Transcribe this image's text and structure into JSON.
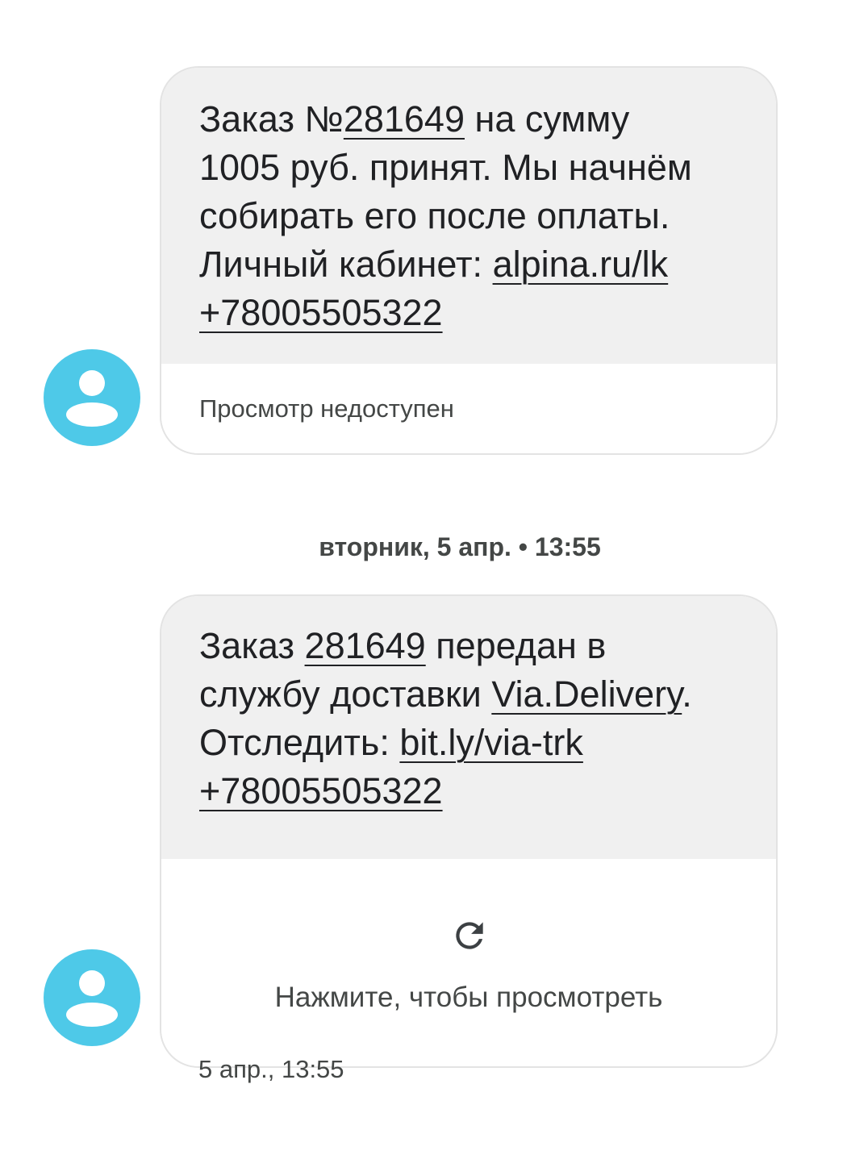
{
  "messages": [
    {
      "text": {
        "l1_a": "Заказ №",
        "l1_link": "281649",
        "l1_b": " на сумму",
        "l2": "1005 руб. принят. Мы начнём",
        "l3": "собирать его после оплаты.",
        "l4_a": "Личный кабинет: ",
        "l4_link": "alpina.ru/lk",
        "l5_link": "+78005505322"
      },
      "preview": "Просмотр недоступен"
    },
    {
      "text": {
        "l1_a": "Заказ ",
        "l1_link": "281649",
        "l1_b": " передан в",
        "l2_a": "службу доставки ",
        "l2_link": "Via.Delivery",
        "l2_b": ".",
        "l3_a": "Отследить: ",
        "l3_link": "bit.ly/via-trk",
        "l4_link": "+78005505322"
      },
      "preview": "Нажмите, чтобы просмотреть",
      "timestamp": "5 апр., 13:55"
    }
  ],
  "date_separator": "вторник, 5 апр. • 13:55",
  "icons": {
    "avatar": "person-icon",
    "refresh": "refresh-icon"
  },
  "colors": {
    "avatar": "#4ec9e8",
    "bubble_bg": "#f0f0f0",
    "bubble_border": "#e3e3e3"
  }
}
